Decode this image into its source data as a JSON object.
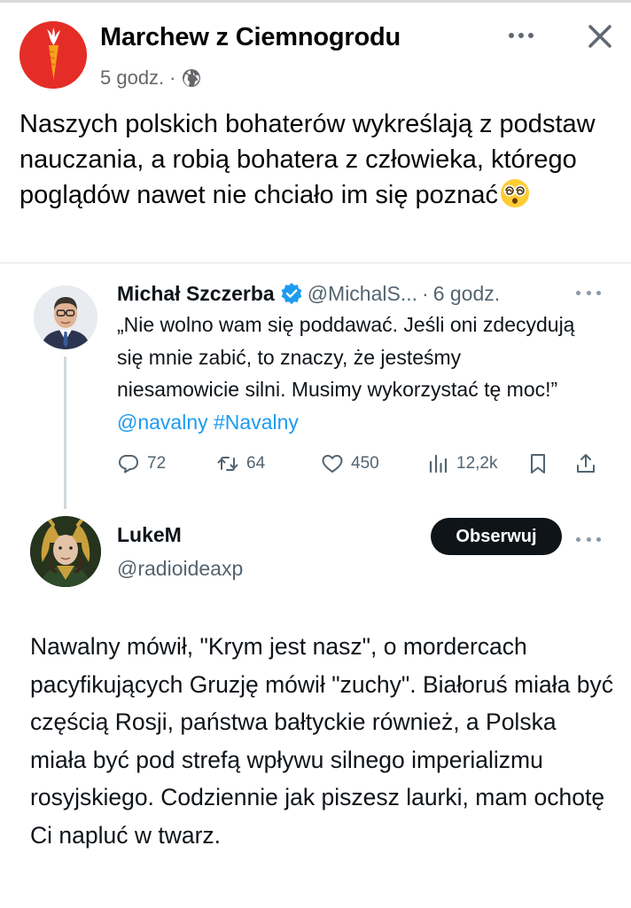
{
  "fb_post": {
    "author": "Marchew z Ciemnogrodu",
    "time": "5 godz.",
    "separator": "·",
    "privacy_icon": "globe-icon",
    "text": "Naszych polskich bohaterów wykreślają z podstaw nauczania, a robią bohatera z człowieka, którego poglądów nawet nie chciało im się poznać",
    "emoji": "dizzy-face-emoji",
    "avatar_color": "#e52d27"
  },
  "tweet1": {
    "name": "Michał Szczerba",
    "handle": "@MichalS...",
    "separator": "·",
    "time": "6 godz.",
    "text": "„Nie wolno wam się poddawać. Jeśli oni zdecydują się mnie zabić, to znaczy, że jesteśmy niesamowicie silni. Musimy wykorzystać tę moc!” ",
    "mention": "@navalny",
    "hashtag": "#Navalny",
    "replies": "72",
    "retweets": "64",
    "likes": "450",
    "views": "12,2k"
  },
  "tweet2": {
    "name": "LukeM",
    "handle": "@radioideaxp",
    "follow_label": "Obserwuj",
    "text": "Nawalny mówił, \"Krym jest nasz\", o mordercach pacyfikujących Gruzję mówił \"zuchy\". Białoruś miała być częścią Rosji, państwa bałtyckie również, a Polska miała być pod strefą wpływu silnego imperializmu rosyjskiego. Codziennie jak piszesz laurki, mam ochotę Ci napluć w twarz."
  },
  "colors": {
    "link": "#1d9bf0",
    "secondary_text": "#536471",
    "verified": "#1d9bf0",
    "follow_button": "#0f1419"
  }
}
